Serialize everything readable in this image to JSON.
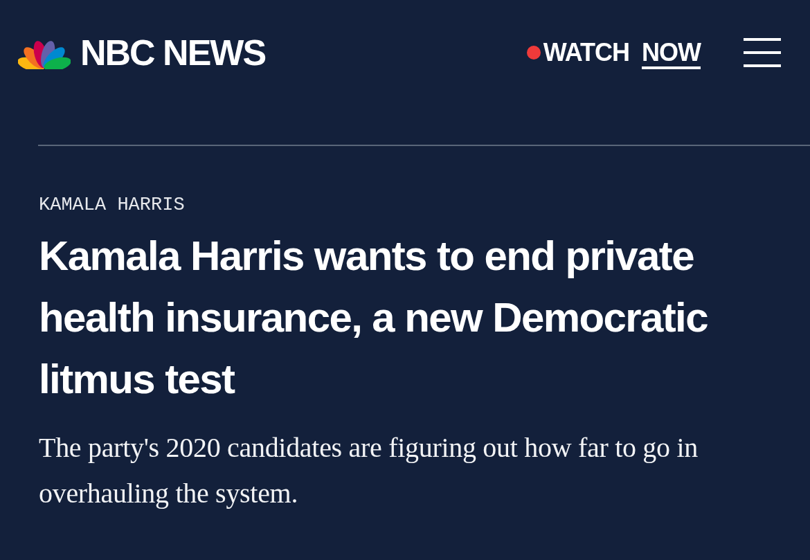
{
  "header": {
    "logo": "NBC NEWS",
    "watch": {
      "label": "WATCH",
      "emphasis": "NOW",
      "live": true
    }
  },
  "article": {
    "category": "KAMALA HARRIS",
    "headline": "Kamala Harris wants to end private health insurance, a new Democratic litmus test",
    "dek": "The party's 2020 candidates are figuring out how far to go in overhauling the system."
  }
}
